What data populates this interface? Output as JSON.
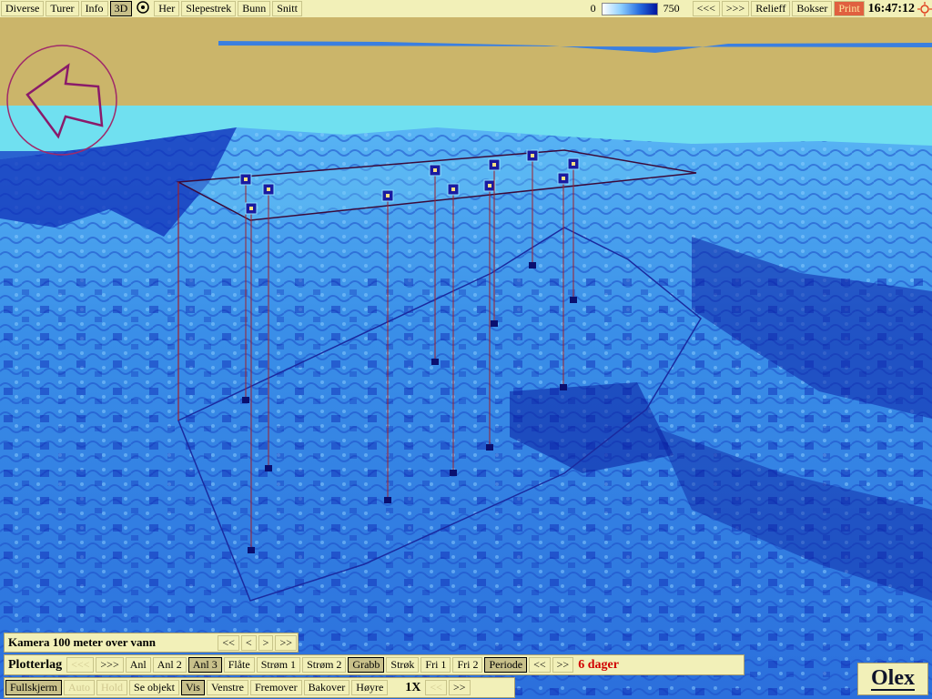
{
  "topbar": {
    "menu": [
      {
        "label": "Diverse",
        "pressed": false
      },
      {
        "label": "Turer",
        "pressed": false
      },
      {
        "label": "Info",
        "pressed": false
      },
      {
        "label": "3D",
        "pressed": true
      }
    ],
    "menu2": [
      {
        "label": "Her"
      },
      {
        "label": "Slepestrek"
      },
      {
        "label": "Bunn"
      },
      {
        "label": "Snitt"
      }
    ],
    "depth_min": "0",
    "depth_max": "750",
    "nav": [
      {
        "label": "<<<"
      },
      {
        "label": ">>>"
      },
      {
        "label": "Relieff"
      },
      {
        "label": "Bokser"
      }
    ],
    "print_label": "Print",
    "clock": "16:47:12"
  },
  "camera_panel": {
    "label": "Kamera 100 meter over vann",
    "buttons": [
      {
        "label": "<<"
      },
      {
        "label": "<"
      },
      {
        "label": ">"
      },
      {
        "label": ">>"
      }
    ]
  },
  "plotterlag_panel": {
    "label": "Plotterlag",
    "buttons": [
      {
        "label": "<<<",
        "state": "dim"
      },
      {
        "label": ">>>",
        "state": ""
      },
      {
        "label": "Anl",
        "state": ""
      },
      {
        "label": "Anl 2",
        "state": ""
      },
      {
        "label": "Anl 3",
        "state": "pressed"
      },
      {
        "label": "Flåte",
        "state": ""
      },
      {
        "label": "Strøm 1",
        "state": ""
      },
      {
        "label": "Strøm 2",
        "state": ""
      },
      {
        "label": "Grabb",
        "state": "pressed"
      },
      {
        "label": "Strøk",
        "state": ""
      },
      {
        "label": "Fri 1",
        "state": ""
      },
      {
        "label": "Fri 2",
        "state": ""
      },
      {
        "label": "Periode",
        "state": "pressed"
      },
      {
        "label": "<<",
        "state": ""
      },
      {
        "label": ">>",
        "state": ""
      }
    ],
    "days": "6 dager"
  },
  "view_panel": {
    "buttons": [
      {
        "label": "Fullskjerm",
        "state": "pressed"
      },
      {
        "label": "Auto",
        "state": "dim"
      },
      {
        "label": "Hold",
        "state": "dim"
      },
      {
        "label": "Se objekt",
        "state": ""
      },
      {
        "label": "Vis",
        "state": "pressed"
      },
      {
        "label": "Venstre",
        "state": ""
      },
      {
        "label": "Fremover",
        "state": ""
      },
      {
        "label": "Bakover",
        "state": ""
      },
      {
        "label": "Høyre",
        "state": ""
      }
    ],
    "speed": "1X",
    "speed_buttons": [
      {
        "label": "<<",
        "state": "dim"
      },
      {
        "label": ">>",
        "state": ""
      }
    ]
  },
  "logo": "Olex",
  "colors": {
    "sky": "#cbb56a",
    "water_surface": "#70e0f0",
    "seabed_light": "#4aa8f0",
    "seabed_dark": "#0a20b0",
    "marker": "#1a1aa0",
    "line": "#a0202a",
    "bar_bg": "#f2f0b8"
  },
  "icons": {
    "compass": "compass-arrow-icon",
    "mode": "target-icon",
    "sun": "sun-icon"
  }
}
